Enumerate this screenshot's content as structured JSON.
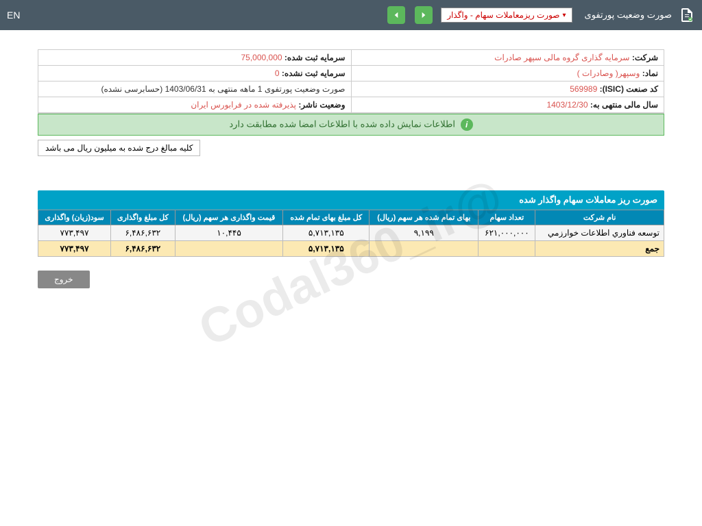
{
  "topbar": {
    "title": "صورت وضعیت پورتفوی",
    "dropdown": "صورت ریزمعاملات سهام - واگذار",
    "lang": "EN"
  },
  "info": {
    "company_label": "شرکت:",
    "company_value": "سرمایه گذاری گروه مالی سپهر صادرات",
    "reg_cap_label": "سرمایه ثبت شده:",
    "reg_cap_value": "75,000,000",
    "symbol_label": "نماد:",
    "symbol_value": "وسپهر( وصادرات )",
    "unreg_cap_label": "سرمایه ثبت نشده:",
    "unreg_cap_value": "0",
    "isic_label": "کد صنعت (ISIC):",
    "isic_value": "569989",
    "portfolio_label": "صورت وضعیت پورتفوی",
    "portfolio_value": "1 ماهه منتهی به 1403/06/31 (حسابرسی نشده)",
    "fy_label": "سال مالی منتهی به:",
    "fy_value": "1403/12/30",
    "publisher_label": "وضعیت ناشر:",
    "publisher_value": "پذیرفته شده در فرابورس ایران"
  },
  "banner": "اطلاعات نمایش داده شده با اطلاعات امضا شده مطابقت دارد",
  "note": "کلیه مبالغ درج شده به میلیون ریال می باشد",
  "section_title": "صورت ریز معاملات سهام واگذار شده",
  "table": {
    "headers": [
      "نام شرکت",
      "تعداد سهام",
      "بهای تمام شده هر سهم (ریال)",
      "کل مبلغ بهای تمام شده",
      "قیمت واگذاری هر سهم (ریال)",
      "کل مبلغ واگذاری",
      "سود(زیان) واگذاری"
    ],
    "row1": [
      "توسعه فناوري اطلاعات خوارزمي",
      "۶۲۱,۰۰۰,۰۰۰",
      "۹,۱۹۹",
      "۵,۷۱۳,۱۳۵",
      "۱۰,۴۴۵",
      "۶,۴۸۶,۶۳۲",
      "۷۷۳,۴۹۷"
    ],
    "sum": [
      "جمع",
      "",
      "",
      "۵,۷۱۳,۱۳۵",
      "",
      "۶,۴۸۶,۶۳۲",
      "۷۷۳,۴۹۷"
    ]
  },
  "exit": "خروج",
  "watermark": "@Codal360_ir"
}
